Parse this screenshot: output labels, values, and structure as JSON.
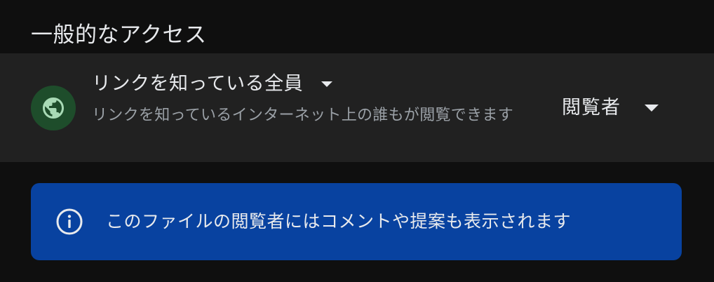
{
  "general_access": {
    "section_title": "一般的なアクセス",
    "link_setting": {
      "title": "リンクを知っている全員",
      "description": "リンクを知っているインターネット上の誰もが閲覧できます",
      "icon": "globe-icon",
      "icon_bg_color": "#1e4d2b",
      "icon_color": "#a8dab5"
    },
    "role": {
      "selected": "閲覧者"
    }
  },
  "info_banner": {
    "icon": "info-icon",
    "text": "このファイルの閲覧者にはコメントや提案も表示されます",
    "background_color": "#0842a0"
  }
}
